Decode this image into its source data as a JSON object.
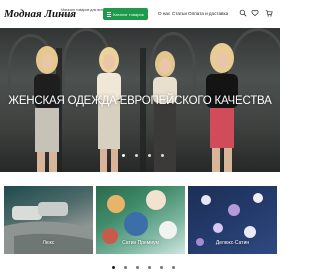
{
  "header": {
    "logo": "Модная Линия",
    "tagline": "Магазин товаров для всей семьи",
    "catalog_button": "Каталог товаров",
    "nav": {
      "about": "О нас",
      "articles": "Статьи",
      "payment": "Оплата и доставка"
    },
    "icons": [
      "search-icon",
      "heart-icon",
      "cart-icon"
    ]
  },
  "hero": {
    "title": "ЖЕНСКАЯ ОДЕЖДА ЕВРОПЕЙСКОГО КАЧЕСТВА",
    "slides": 4,
    "active_slide": 1
  },
  "categories": [
    {
      "label": "Люкс"
    },
    {
      "label": "Сатин Премиум"
    },
    {
      "label": "Делюкс-Сатин"
    }
  ],
  "carousel": {
    "pages": 6,
    "active_page": 1
  },
  "colors": {
    "accent": "#1d9a4a"
  }
}
